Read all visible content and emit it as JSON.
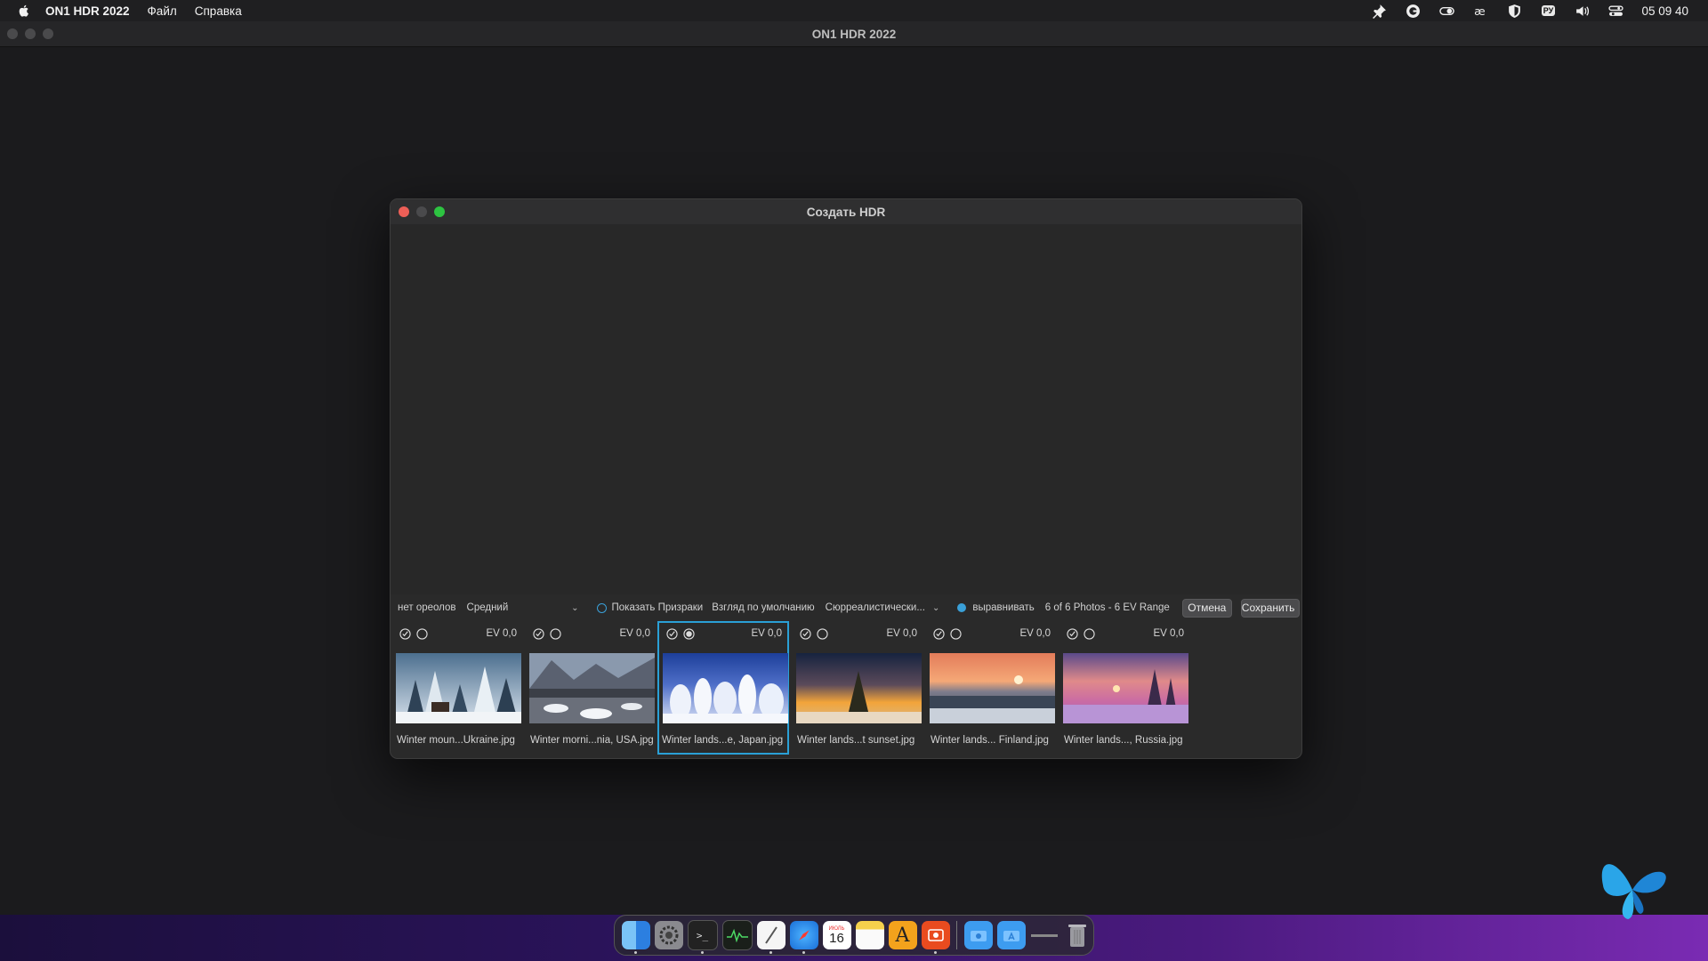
{
  "menubar": {
    "app_name": "ON1 HDR 2022",
    "menus": [
      "Файл",
      "Справка"
    ],
    "keyboard_layout": "РУ",
    "clock": "05 09 40"
  },
  "main_window": {
    "title": "ON1 HDR 2022"
  },
  "dialog": {
    "title": "Создать HDR",
    "controls": {
      "halo_label": "нет ореолов",
      "halo_value": "Средний",
      "show_ghosts": "Показать Призраки",
      "default_view": "Взгляд по умолчанию",
      "preset_value": "Сюрреалистически...",
      "align": "выравнивать",
      "photo_count": "6 of 6 Photos - 6 EV Range",
      "cancel": "Отмена",
      "save": "Сохранить"
    },
    "thumbnails": [
      {
        "ev": "EV 0,0",
        "name": "Winter moun...Ukraine.jpg",
        "selected": false
      },
      {
        "ev": "EV 0,0",
        "name": "Winter morni...nia, USA.jpg",
        "selected": false
      },
      {
        "ev": "EV 0,0",
        "name": "Winter lands...e, Japan.jpg",
        "selected": true
      },
      {
        "ev": "EV 0,0",
        "name": "Winter lands...t sunset.jpg",
        "selected": false
      },
      {
        "ev": "EV 0,0",
        "name": "Winter lands... Finland.jpg",
        "selected": false
      },
      {
        "ev": "EV 0,0",
        "name": "Winter lands..., Russia.jpg",
        "selected": false
      }
    ]
  },
  "dock": {
    "calendar_day": "16",
    "calendar_month": "ИЮЛЬ"
  },
  "colors": {
    "accent": "#2aa0d6",
    "dialog_bg": "#2a2a2a"
  }
}
